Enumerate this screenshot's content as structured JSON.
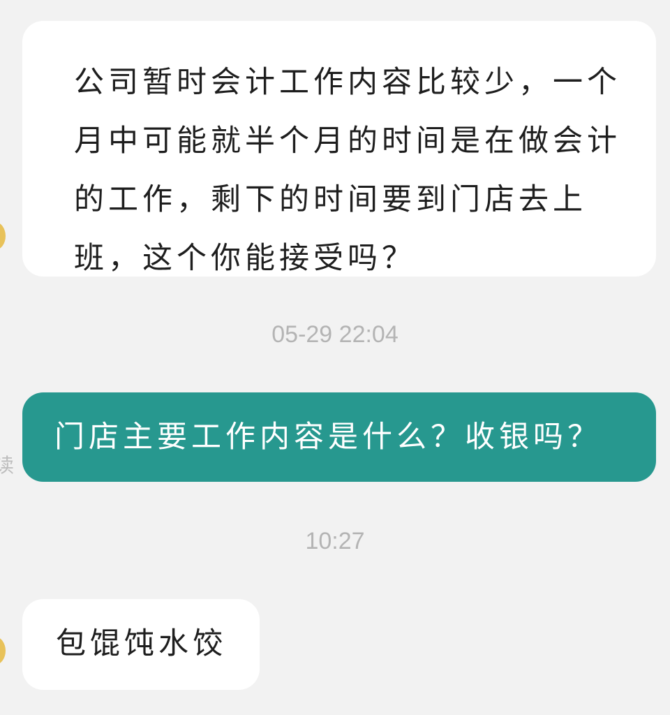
{
  "messages": [
    {
      "direction": "incoming",
      "text": "公司暂时会计工作内容比较少，一个月中可能就半个月的时间是在做会计的工作，剩下的时间要到门店去上班，这个你能接受吗？"
    },
    {
      "type": "timestamp",
      "text": "05-29 22:04"
    },
    {
      "direction": "outgoing",
      "text": "门店主要工作内容是什么？收银吗？",
      "read_status": "读"
    },
    {
      "type": "timestamp",
      "text": "10:27"
    },
    {
      "direction": "incoming",
      "text": "包馄饨水饺"
    }
  ],
  "colors": {
    "background": "#f2f2f2",
    "incoming_bubble": "#ffffff",
    "outgoing_bubble": "#27988f",
    "timestamp_text": "#b4b4b4",
    "avatar": "#e8c25a"
  }
}
